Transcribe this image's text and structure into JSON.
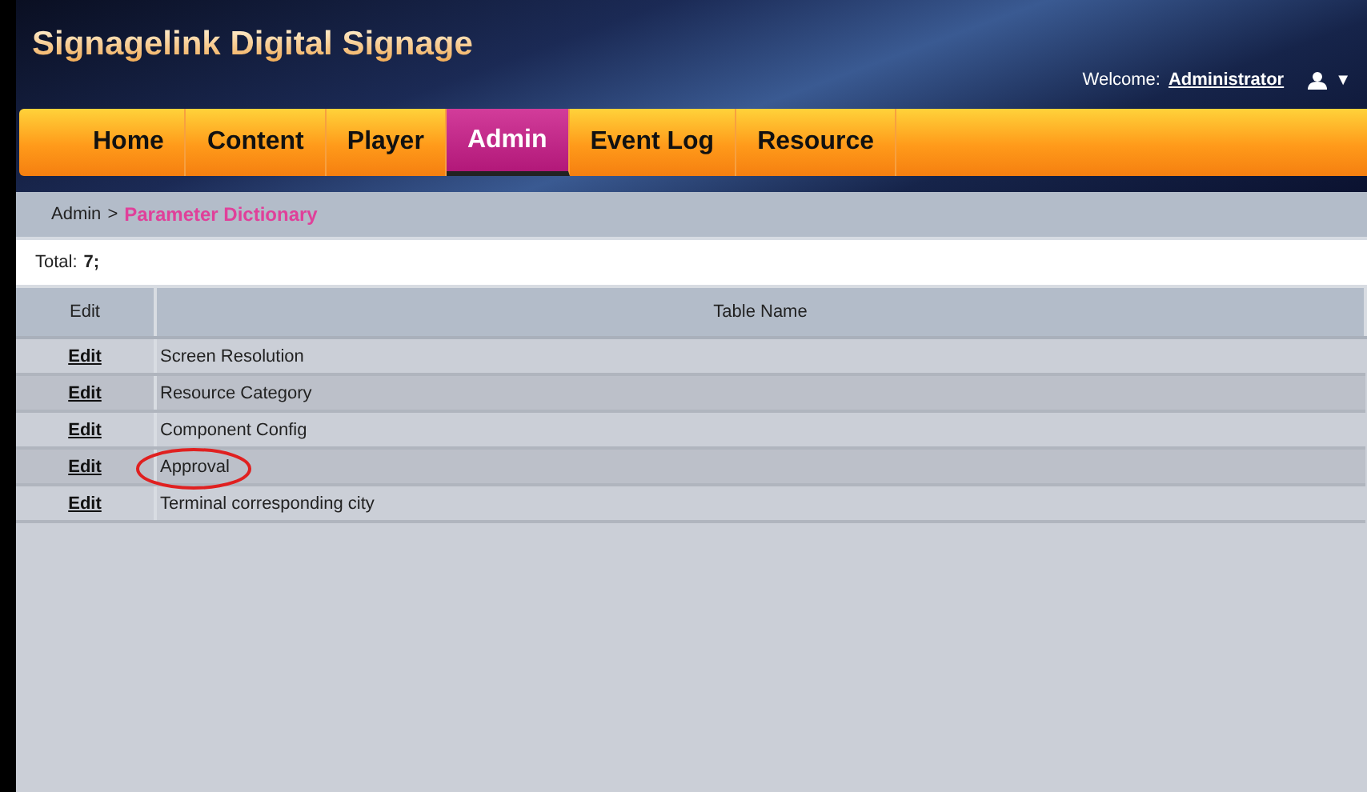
{
  "header": {
    "title": "Signagelink Digital Signage",
    "welcome_label": "Welcome:",
    "user": "Administrator",
    "user_menu_caret": "▼"
  },
  "nav": [
    {
      "label": "Home",
      "selected": false
    },
    {
      "label": "Content",
      "selected": false
    },
    {
      "label": "Player",
      "selected": false
    },
    {
      "label": "Admin",
      "selected": true
    },
    {
      "label": "Event Log",
      "selected": false
    },
    {
      "label": "Resource",
      "selected": false
    }
  ],
  "breadcrumb": {
    "parent": "Admin",
    "separator": ">",
    "current": "Parameter Dictionary"
  },
  "total": {
    "label": "Total:",
    "value": "7;"
  },
  "table": {
    "columns": [
      "Edit",
      "Table Name"
    ],
    "rows": [
      {
        "action": "Edit",
        "name": "Screen Resolution",
        "circled": false
      },
      {
        "action": "Edit",
        "name": "Resource Category",
        "circled": false
      },
      {
        "action": "Edit",
        "name": "Component Config",
        "circled": false
      },
      {
        "action": "Edit",
        "name": "Approval",
        "circled": true
      },
      {
        "action": "Edit",
        "name": "Terminal corresponding city",
        "circled": false
      }
    ]
  }
}
